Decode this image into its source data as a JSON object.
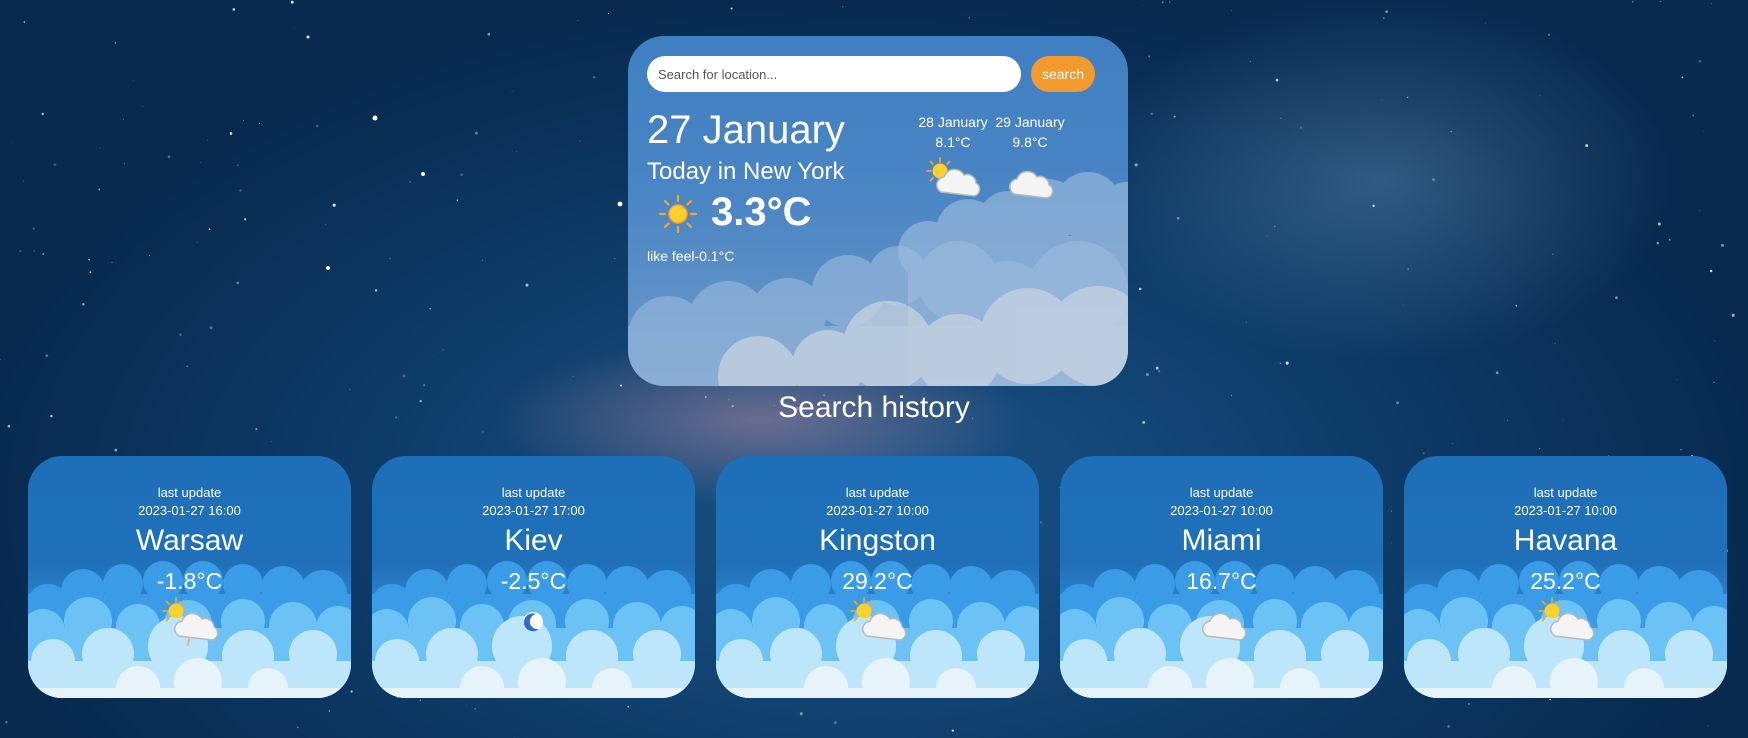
{
  "search": {
    "placeholder": "Search for location...",
    "value": "",
    "button_label": "search"
  },
  "current": {
    "date": "27 January",
    "location_text": "Today in New York",
    "icon": "sun-icon",
    "temperature": "3.3°C",
    "feels_like": "like feel-0.1°C"
  },
  "forecast": [
    {
      "date": "28 January",
      "temp": "8.1°C",
      "icon": "partly-cloudy-icon"
    },
    {
      "date": "29 January",
      "temp": "9.8°C",
      "icon": "cloud-icon"
    }
  ],
  "history": {
    "title": "Search history",
    "cards": [
      {
        "label": "last update",
        "time": "2023-01-27 16:00",
        "city": "Warsaw",
        "temp": "-1.8°C",
        "icon": "partly-cloudy-rain-icon"
      },
      {
        "label": "last update",
        "time": "2023-01-27 17:00",
        "city": "Kiev",
        "temp": "-2.5°C",
        "icon": "moon-icon"
      },
      {
        "label": "last update",
        "time": "2023-01-27 10:00",
        "city": "Kingston",
        "temp": "29.2°C",
        "icon": "partly-cloudy-icon"
      },
      {
        "label": "last update",
        "time": "2023-01-27 10:00",
        "city": "Miami",
        "temp": "16.7°C",
        "icon": "cloud-icon"
      },
      {
        "label": "last update",
        "time": "2023-01-27 10:00",
        "city": "Havana",
        "temp": "25.2°C",
        "icon": "partly-cloudy-icon"
      }
    ]
  },
  "colors": {
    "accent": "#f29a2e",
    "card": "#4a85c4",
    "history_card": "#1f70b9",
    "background": "#0d3a66"
  }
}
